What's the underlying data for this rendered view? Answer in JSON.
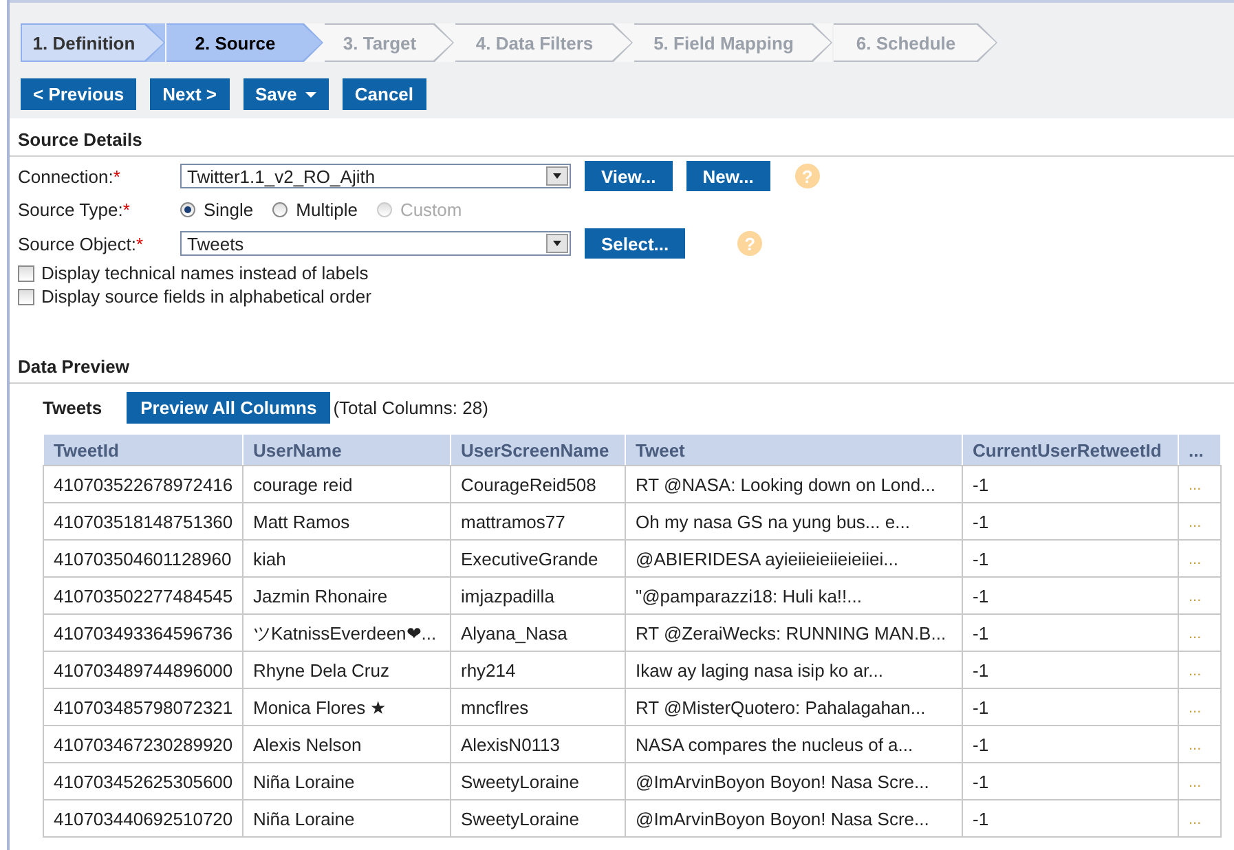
{
  "wizard_steps": [
    {
      "label": "1. Definition",
      "selected": false,
      "completed": true
    },
    {
      "label": "2. Source",
      "selected": true,
      "completed": false
    },
    {
      "label": "3. Target",
      "selected": false,
      "completed": false
    },
    {
      "label": "4. Data Filters",
      "selected": false,
      "completed": false
    },
    {
      "label": "5. Field Mapping",
      "selected": false,
      "completed": false
    },
    {
      "label": "6. Schedule",
      "selected": false,
      "completed": false
    }
  ],
  "toolbar": [
    {
      "label": "< Previous",
      "kind": "plain"
    },
    {
      "label": "Next >",
      "kind": "plain"
    },
    {
      "label": "Save",
      "kind": "menu"
    },
    {
      "label": "Cancel",
      "kind": "plain"
    }
  ],
  "source_details": {
    "title": "Source Details",
    "connection": {
      "label": "Connection:",
      "required": "*",
      "value": "Twitter1.1_v2_RO_Ajith",
      "buttons": [
        "View...",
        "New..."
      ],
      "help": "?"
    },
    "source_type": {
      "label": "Source Type:",
      "required": "*",
      "options": [
        {
          "label": "Single",
          "selected": true,
          "disabled": false
        },
        {
          "label": "Multiple",
          "selected": false,
          "disabled": false
        },
        {
          "label": "Custom",
          "selected": false,
          "disabled": true
        }
      ]
    },
    "source_object": {
      "label": "Source Object:",
      "required": "*",
      "value": "Tweets",
      "buttons": [
        "Select..."
      ],
      "help": "?"
    },
    "checkboxes": [
      {
        "label": "Display technical names instead of labels",
        "checked": false
      },
      {
        "label": "Display source fields in alphabetical order",
        "checked": false
      }
    ]
  },
  "data_preview": {
    "title": "Data Preview",
    "object": "Tweets",
    "button": "Preview All Columns",
    "total": "(Total Columns: 28)",
    "table": {
      "columns": [
        "TweetId",
        "UserName",
        "UserScreenName",
        "Tweet",
        "CurrentUserRetweetId",
        "..."
      ],
      "rows": [
        [
          "410703522678972416",
          "courage reid",
          "CourageReid508",
          "RT @NASA: Looking down on Lond...",
          "-1",
          "..."
        ],
        [
          "410703518148751360",
          "Matt Ramos",
          "mattramos77",
          "Oh my nasa GS na yung bus... e...",
          "-1",
          "..."
        ],
        [
          "410703504601128960",
          "kiah",
          "ExecutiveGrande",
          "@ABIERIDESA ayieiieieiieieiiei...",
          "-1",
          "..."
        ],
        [
          "410703502277484545",
          "Jazmin Rhonaire",
          "imjazpadilla",
          "\"@pamparazzi18: Huli ka!!...",
          "-1",
          "..."
        ],
        [
          "410703493364596736",
          "ツKatnissEverdeen❤...",
          "Alyana_Nasa",
          "RT @ZeraiWecks: RUNNING MAN.B...",
          "-1",
          "..."
        ],
        [
          "410703489744896000",
          "Rhyne Dela Cruz",
          "rhy214",
          "Ikaw ay laging nasa isip ko ar...",
          "-1",
          "..."
        ],
        [
          "410703485798072321",
          "Monica Flores ★",
          "mncflres",
          "RT @MisterQuotero: Pahalagahan...",
          "-1",
          "..."
        ],
        [
          "410703467230289920",
          "Alexis Nelson",
          "AlexisN0113",
          "NASA compares the nucleus of a...",
          "-1",
          "..."
        ],
        [
          "410703452625305600",
          "Niña Loraine",
          "SweetyLoraine",
          "@ImArvinBoyon Boyon! Nasa Scre...",
          "-1",
          "..."
        ],
        [
          "410703440692510720",
          "Niña Loraine",
          "SweetyLoraine",
          "@ImArvinBoyon Boyon! Nasa Scre...",
          "-1",
          "..."
        ]
      ]
    }
  }
}
